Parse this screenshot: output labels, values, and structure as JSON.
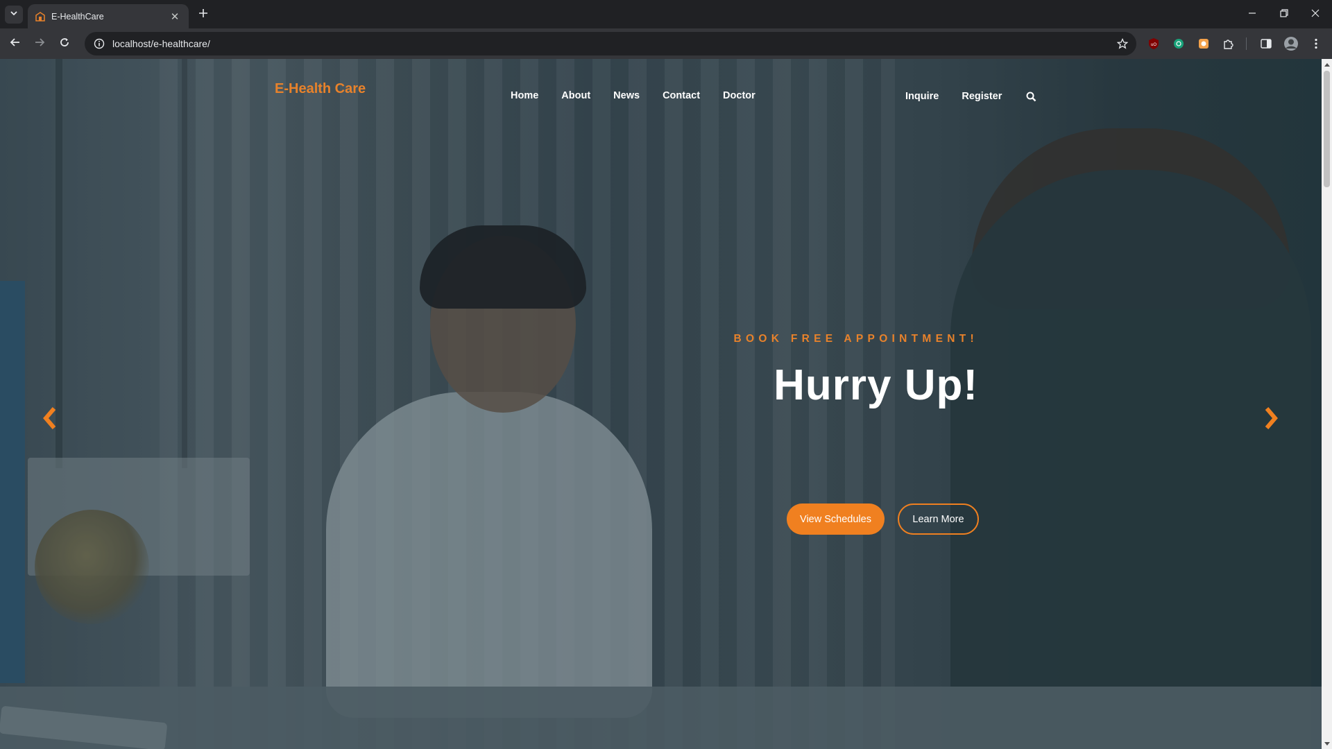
{
  "browser": {
    "tab": {
      "title": "E-HealthCare",
      "close_icon": "close-icon"
    },
    "url": "localhost/e-healthcare/",
    "icons": {
      "tab_list": "chevron-down-icon",
      "new_tab": "plus-icon",
      "back": "arrow-left-icon",
      "forward": "arrow-right-icon",
      "reload": "reload-icon",
      "site_info": "info-icon",
      "bookmark": "star-icon",
      "extensions": [
        "ublock-icon",
        "chatgpt-icon",
        "color-picker-icon",
        "puzzle-icon"
      ],
      "side_panel": "side-panel-icon",
      "profile": "avatar",
      "menu": "more-vert-icon"
    },
    "colors": {
      "chrome_dark": "#202124",
      "chrome_toolbar": "#35363a",
      "text": "#e8eaed"
    }
  },
  "site": {
    "logo": "E-Health Care",
    "nav_left": [
      "Home",
      "About",
      "News",
      "Contact",
      "Doctor"
    ],
    "nav_right": [
      "Inquire",
      "Register"
    ],
    "search_icon": "search-icon",
    "colors": {
      "accent": "#f08020",
      "logo": "#e8822b",
      "nav_text": "#ffffff"
    }
  },
  "hero": {
    "subtitle": "BOOK FREE APPOINTMENT!",
    "title": "Hurry Up!",
    "primary_button": "View Schedules",
    "secondary_button": "Learn More",
    "prev_icon": "chevron-left-icon",
    "next_icon": "chevron-right-icon"
  }
}
